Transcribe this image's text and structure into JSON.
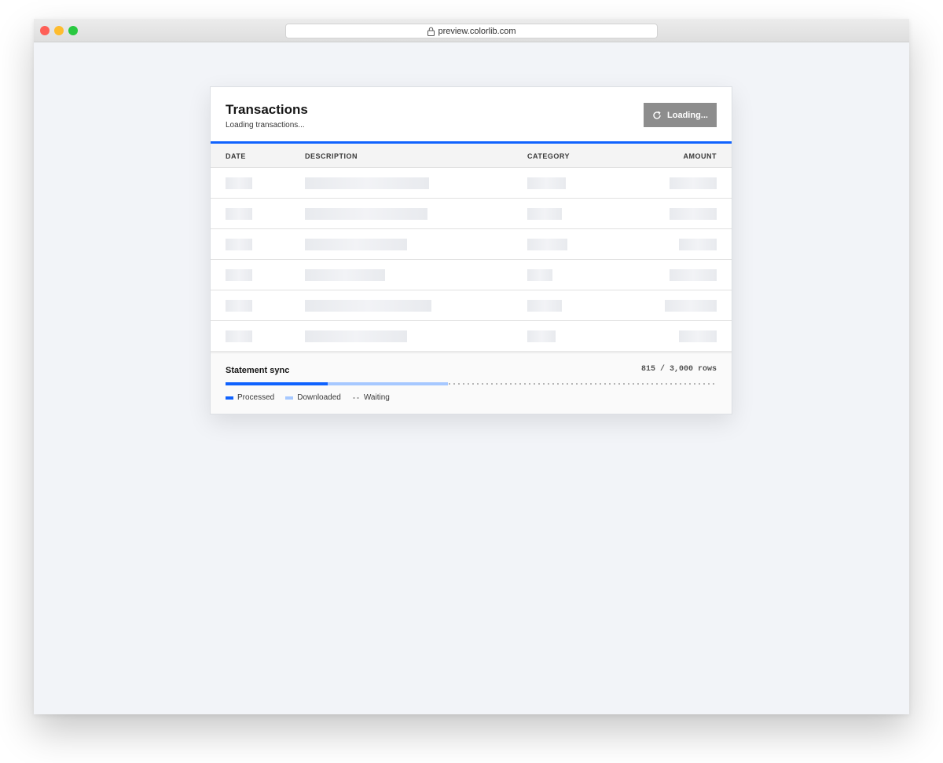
{
  "browser": {
    "url": "preview.colorlib.com"
  },
  "header": {
    "title": "Transactions",
    "subtitle": "Loading transactions...",
    "button_label": "Loading..."
  },
  "table": {
    "columns": [
      "DATE",
      "DESCRIPTION",
      "CATEGORY",
      "AMOUNT"
    ],
    "rows": [
      {
        "desc_w": 0.56,
        "cat_w": 0.2,
        "amt_w": 0.2
      },
      {
        "desc_w": 0.55,
        "cat_w": 0.18,
        "amt_w": 0.2
      },
      {
        "desc_w": 0.46,
        "cat_w": 0.21,
        "amt_w": 0.16
      },
      {
        "desc_w": 0.36,
        "cat_w": 0.13,
        "amt_w": 0.2
      },
      {
        "desc_w": 0.57,
        "cat_w": 0.18,
        "amt_w": 0.22
      },
      {
        "desc_w": 0.46,
        "cat_w": 0.15,
        "amt_w": 0.16
      }
    ]
  },
  "sync": {
    "label": "Statement sync",
    "count_text": "815 / 3,000 rows",
    "processed_fraction": 0.208,
    "downloaded_fraction": 0.453,
    "legend": [
      "Processed",
      "Downloaded",
      "Waiting"
    ]
  },
  "colors": {
    "accent": "#0f62fe",
    "downloaded": "#a6c8ff",
    "button": "#8d8d8d"
  }
}
